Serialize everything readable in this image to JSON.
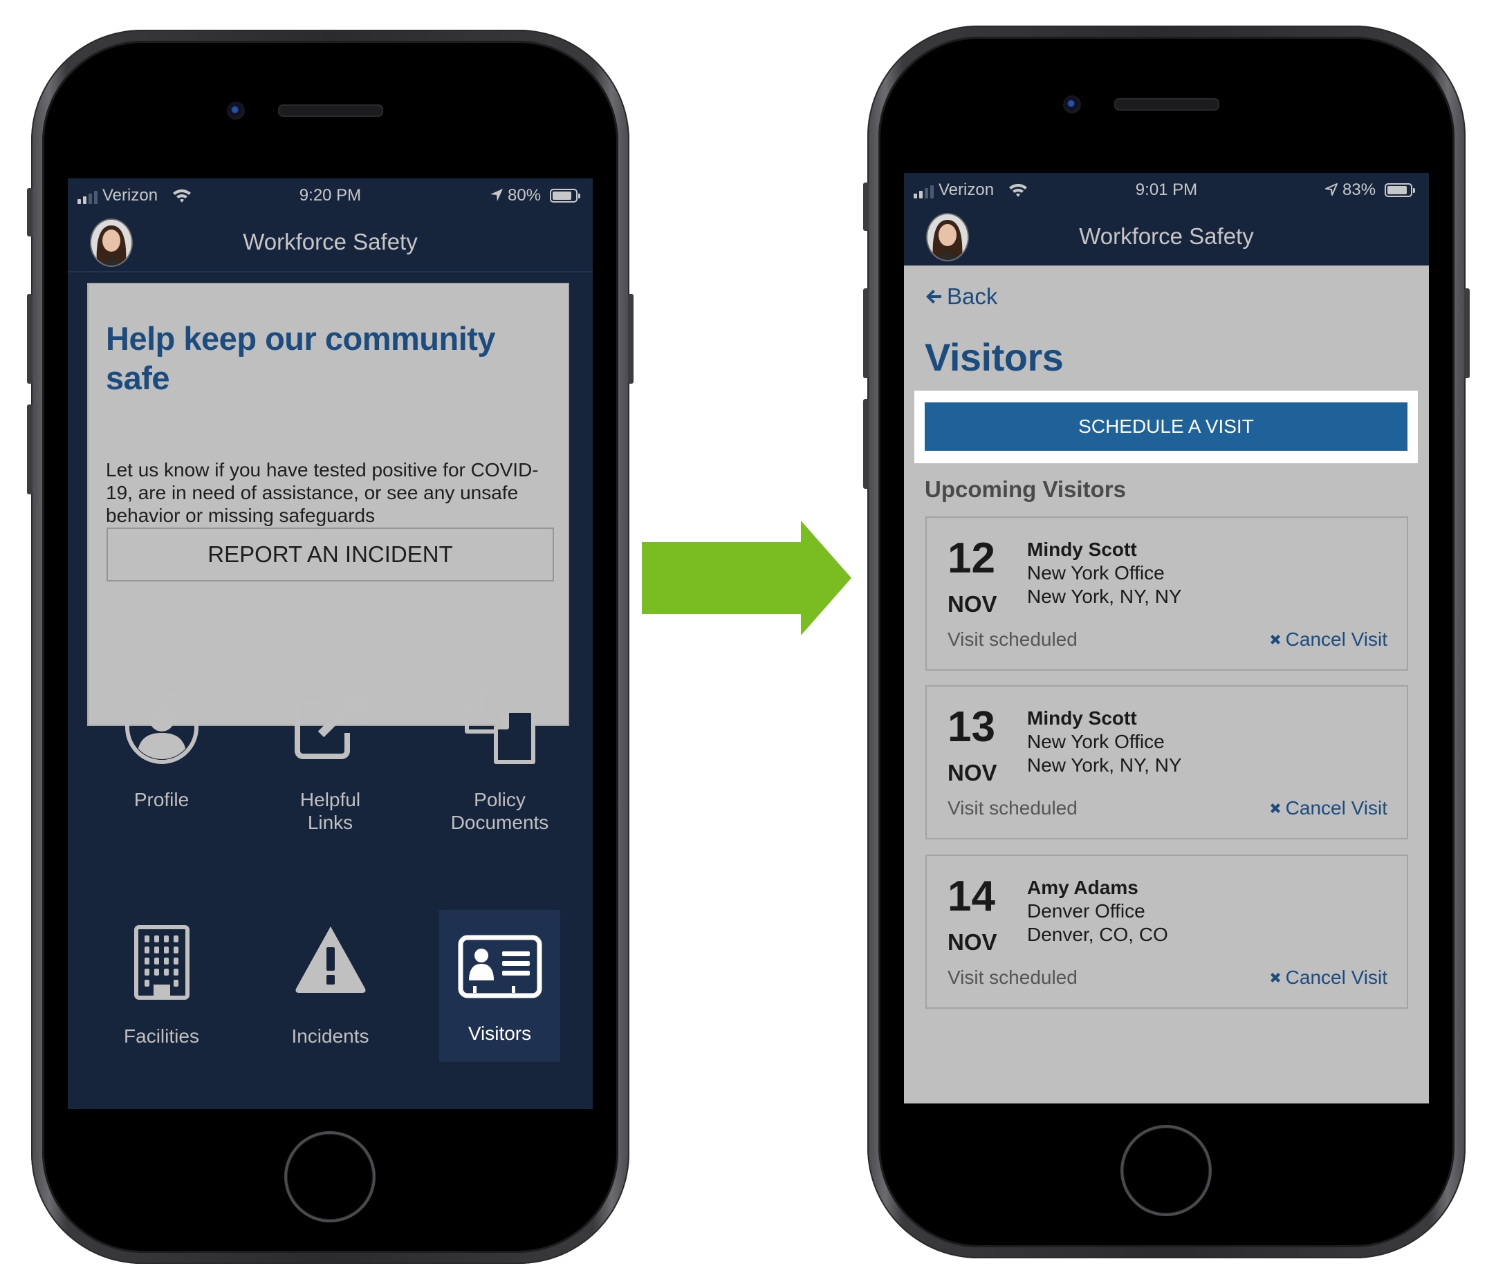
{
  "colors": {
    "navy": "#16243c",
    "brand_blue": "#1c4c7e",
    "primary_button": "#1f6299",
    "panel_gray": "#bfbfbf",
    "arrow_green": "#7abd22"
  },
  "left_phone": {
    "status_bar": {
      "carrier": "Verizon",
      "time": "9:20 PM",
      "battery_percent": "80%",
      "battery_level": 0.8,
      "location_icon": "location-arrow-filled-icon",
      "wifi_icon": "wifi-icon",
      "signal_bars": 2
    },
    "app_bar": {
      "title": "Workforce Safety",
      "avatar_icon": "user-avatar-photo"
    },
    "promo_card": {
      "headline": "Help keep our community safe",
      "body": "Let us know if you have tested positive for COVID-19, are in need of assistance, or see any unsafe behavior or missing safeguards",
      "button_label": "REPORT AN INCIDENT"
    },
    "tiles": [
      {
        "label": "Profile",
        "icon": "user-circle-icon",
        "active": false
      },
      {
        "label": "Helpful Links",
        "icon": "external-link-icon",
        "active": false
      },
      {
        "label": "Policy Documents",
        "icon": "documents-icon",
        "active": false
      },
      {
        "label": "Facilities",
        "icon": "building-icon",
        "active": false
      },
      {
        "label": "Incidents",
        "icon": "warning-triangle-icon",
        "active": false
      },
      {
        "label": "Visitors",
        "icon": "id-card-icon",
        "active": true
      }
    ]
  },
  "transition_arrow": {
    "icon": "arrow-right-icon"
  },
  "right_phone": {
    "status_bar": {
      "carrier": "Verizon",
      "time": "9:01 PM",
      "battery_percent": "83%",
      "battery_level": 0.83,
      "location_icon": "location-arrow-outline-icon",
      "wifi_icon": "wifi-icon",
      "signal_bars": 2
    },
    "app_bar": {
      "title": "Workforce Safety",
      "avatar_icon": "user-avatar-photo"
    },
    "back_label": "Back",
    "page_title": "Visitors",
    "schedule_button_label": "SCHEDULE A VISIT",
    "section_title": "Upcoming Visitors",
    "visits": [
      {
        "day": "12",
        "month": "NOV",
        "visitor": "Mindy Scott",
        "office": "New York Office",
        "address": "New York, NY, NY",
        "status": "Visit scheduled",
        "cancel_label": "Cancel Visit"
      },
      {
        "day": "13",
        "month": "NOV",
        "visitor": "Mindy Scott",
        "office": "New York Office",
        "address": "New York, NY, NY",
        "status": "Visit scheduled",
        "cancel_label": "Cancel Visit"
      },
      {
        "day": "14",
        "month": "NOV",
        "visitor": "Amy Adams",
        "office": "Denver Office",
        "address": "Denver, CO, CO",
        "status": "Visit scheduled",
        "cancel_label": "Cancel Visit"
      }
    ]
  }
}
